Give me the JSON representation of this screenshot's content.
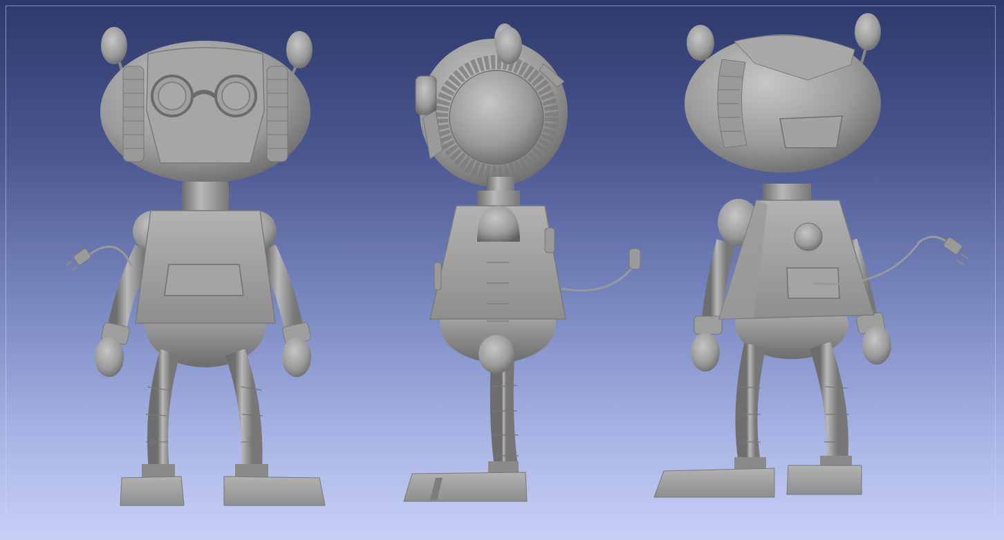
{
  "scene": {
    "background_top": "#2e3a6b",
    "background_bottom": "#c7d0f6",
    "model_color": "#9e9e9e",
    "views": [
      {
        "name": "front"
      },
      {
        "name": "side"
      },
      {
        "name": "back"
      }
    ]
  }
}
